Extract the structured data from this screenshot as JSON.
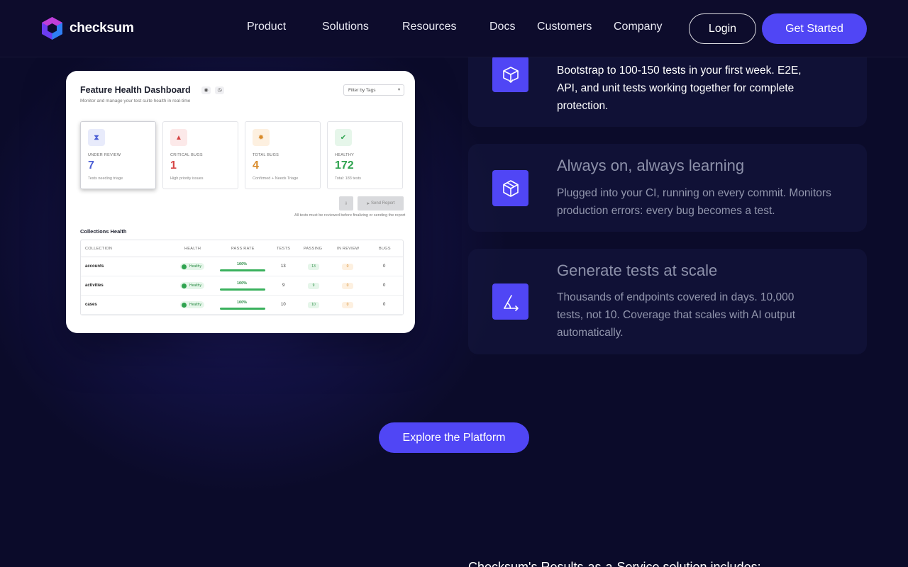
{
  "nav": {
    "logo_text": "checksum",
    "links": [
      "Product",
      "Solutions",
      "Resources",
      "Docs",
      "Customers",
      "Company"
    ],
    "login_label": "Login",
    "get_started_label": "Get Started"
  },
  "dashboard": {
    "title": "Feature Health Dashboard",
    "subtitle": "Monitor and manage your test suite health in real-time",
    "filter_placeholder": "Filter by Tags",
    "stats": [
      {
        "label": "UNDER REVIEW",
        "value": "7",
        "sub": "Tests needing triage",
        "color": "#4c5fd5",
        "bg": "#e8ebfb"
      },
      {
        "label": "CRITICAL BUGS",
        "value": "1",
        "sub": "High priority issues",
        "color": "#d64545",
        "bg": "#fce9e9"
      },
      {
        "label": "TOTAL BUGS",
        "value": "4",
        "sub": "Confirmed + Needs Triage",
        "color": "#d88a2a",
        "bg": "#fdf0e0"
      },
      {
        "label": "HEALTHY",
        "value": "172",
        "sub": "Total: 183 tests",
        "color": "#2fa34f",
        "bg": "#e6f6ea"
      }
    ],
    "send_report_label": "Send Report",
    "note": "All tests must be reviewed before finalizing or sending the report",
    "collections_title": "Collections Health",
    "columns": [
      "COLLECTION",
      "HEALTH",
      "PASS RATE",
      "TESTS",
      "PASSING",
      "IN REVIEW",
      "BUGS"
    ],
    "rows": [
      {
        "name": "accounts",
        "health": "Healthy",
        "pass_rate": "100%",
        "tests": "13",
        "passing": "13",
        "in_review": "0",
        "bugs": "0"
      },
      {
        "name": "activities",
        "health": "Healthy",
        "pass_rate": "100%",
        "tests": "9",
        "passing": "9",
        "in_review": "0",
        "bugs": "0"
      },
      {
        "name": "cases",
        "health": "Healthy",
        "pass_rate": "100%",
        "tests": "10",
        "passing": "10",
        "in_review": "0",
        "bugs": "0"
      }
    ]
  },
  "features": [
    {
      "icon": "box-arrow-down-icon",
      "title": "",
      "desc": "Bootstrap to 100-150 tests in your first week. E2E, API, and unit tests working together for complete protection."
    },
    {
      "icon": "cube-icon",
      "title": "Always on, always learning",
      "desc": "Plugged into your CI, running on every commit. Monitors production errors: every bug becomes a test."
    },
    {
      "icon": "scale-angle-icon",
      "title": "Generate tests at scale",
      "desc": "Thousands of endpoints covered in days. 10,000 tests, not 10. Coverage that scales with AI output automatically."
    }
  ],
  "explore_label": "Explore the Platform",
  "bottom_text": "Checksum's Results-as-a-Service solution includes:",
  "colors": {
    "accent": "#5046f5",
    "background": "#0b0b2a"
  }
}
